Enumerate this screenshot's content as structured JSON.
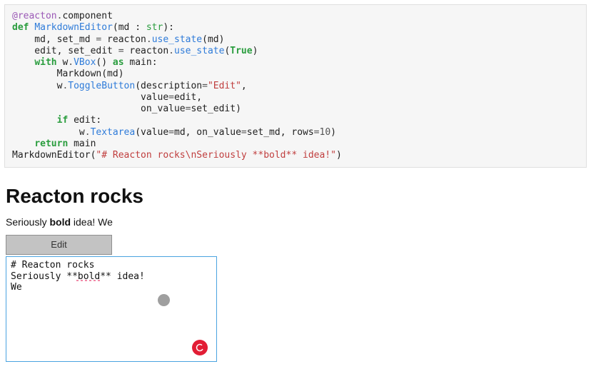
{
  "code": {
    "decorator_at": "@reacton",
    "decorator_dot": ".",
    "decorator_attr": "component",
    "def": "def",
    "funcname": "MarkdownEditor",
    "paren_open": "(md : ",
    "type": "str",
    "paren_close": "):",
    "line3_a": "    md, set_md ",
    "eq": "=",
    "line3_b": " reacton",
    "use_state": "use_state",
    "line3_c": "(md)",
    "line4_a": "    edit, set_edit ",
    "line4_b": " reacton",
    "line4_c": "(",
    "true": "True",
    "line4_d": ")",
    "with": "with",
    "w": " w",
    "vbox": "VBox",
    "line5_b": "() ",
    "as": "as",
    "line5_c": " main:",
    "line6": "        Markdown(md)",
    "line7_a": "        w",
    "togglebtn": "ToggleButton",
    "line7_b": "(description",
    "str_edit": "\"Edit\"",
    "line7_c": ",",
    "line8_a": "                       value",
    "line8_b": "edit,",
    "line9_a": "                       on_value",
    "line9_b": "set_edit)",
    "if": "if",
    "line10_b": " edit:",
    "line11_a": "            w",
    "textarea": "Textarea",
    "line11_b": "(value",
    "line11_c": "md, on_value",
    "line11_d": "set_md, rows",
    "ten": "10",
    "line11_e": ")",
    "return": "return",
    "line12_b": " main",
    "line13_a": "MarkdownEditor(",
    "str_md": "\"# Reacton rocks\\nSeriously **bold** idea!\"",
    "line13_b": ")"
  },
  "rendered": {
    "h1": "Reacton rocks",
    "p_pre": "Seriously ",
    "p_bold": "bold",
    "p_post": " idea! We"
  },
  "ui": {
    "edit_label": "Edit",
    "textarea_value": "# Reacton rocks\nSeriously **bold** idea!\nWe "
  }
}
